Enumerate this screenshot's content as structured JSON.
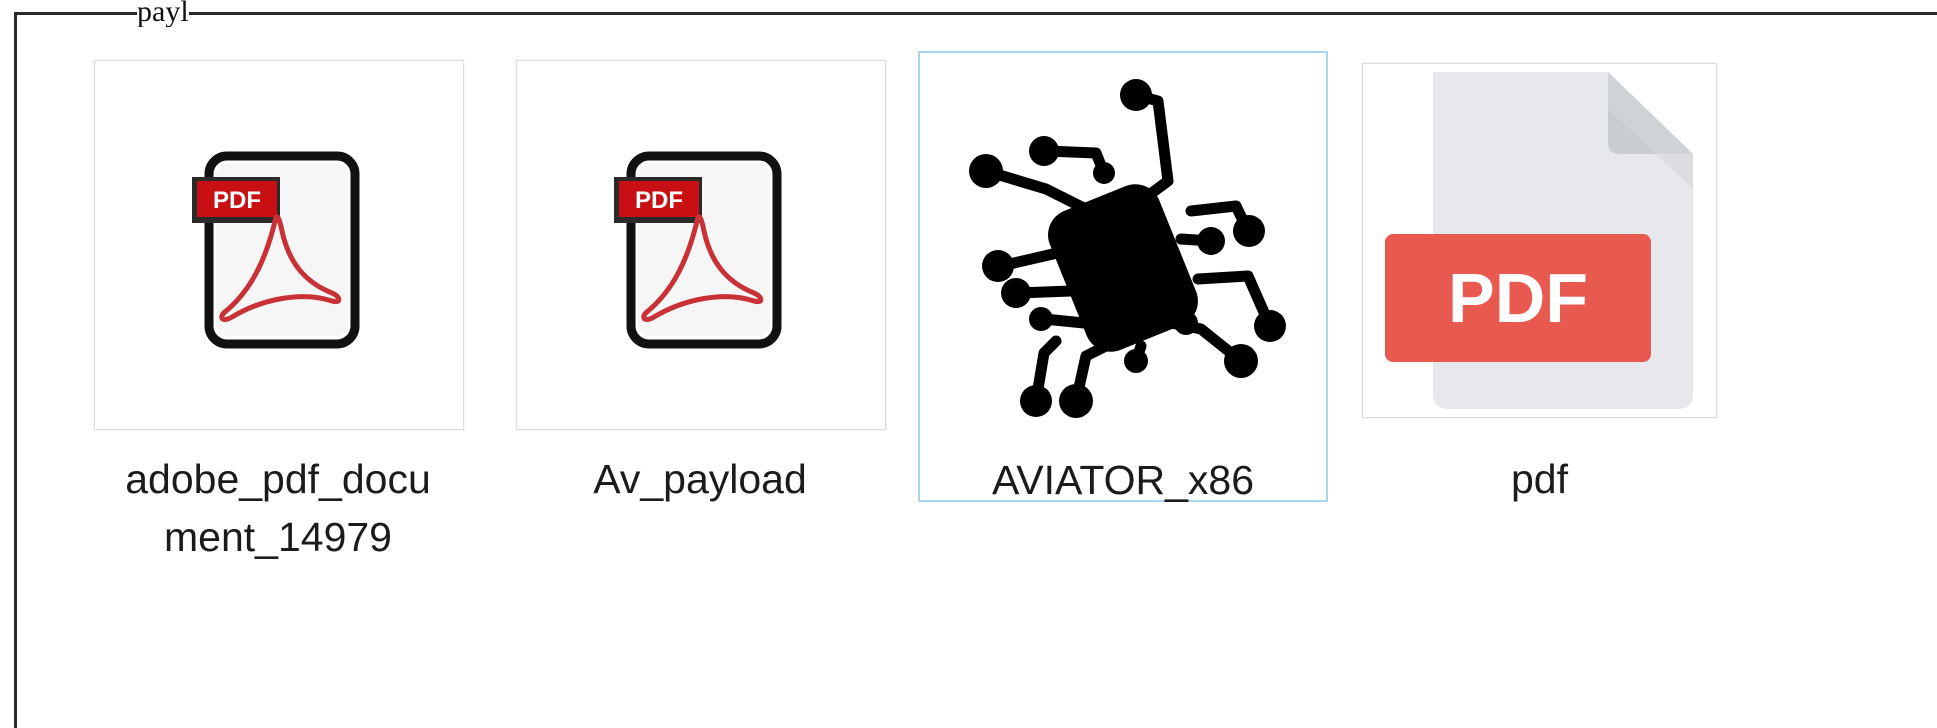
{
  "window": {
    "top_text": "payl"
  },
  "files": [
    {
      "name": "adobe_pdf_document_14979",
      "name_line1": "adobe_pdf_docu",
      "name_line2": "ment_14979",
      "icon": "adobe-pdf-icon"
    },
    {
      "name": "Av_payload",
      "icon": "adobe-pdf-icon"
    },
    {
      "name": "AVIATOR_x86",
      "icon": "circuit-chip-icon",
      "selected": true
    },
    {
      "name": "pdf",
      "icon": "pdf-document-icon"
    }
  ],
  "colors": {
    "selection_border": "#a9d4ee",
    "pdf_red": "#e85a4f",
    "adobe_red": "#c00000",
    "page_gray": "#e6e8eb"
  }
}
